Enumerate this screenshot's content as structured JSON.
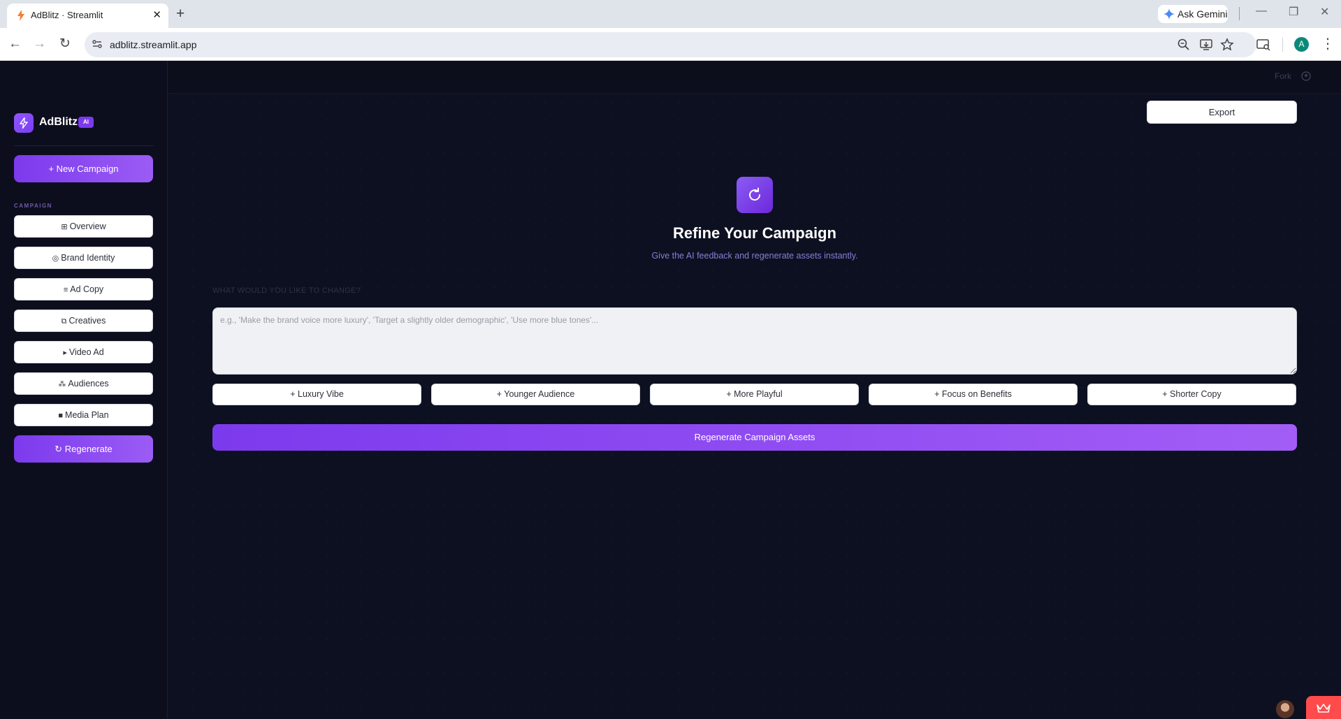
{
  "browser": {
    "tab_title": "AdBlitz · Streamlit",
    "tab_close": "✕",
    "new_tab": "+",
    "gemini_label": "Ask Gemini",
    "window_controls": {
      "minimize": "—",
      "restore": "❐",
      "close": "✕"
    },
    "nav": {
      "back": "←",
      "forward": "→",
      "reload": "↻"
    },
    "url": "adblitz.streamlit.app",
    "profile_initial": "A",
    "menu": "⋮"
  },
  "header": {
    "fork_label": "Fork"
  },
  "sidebar": {
    "brand_name": "AdBlitz",
    "brand_badge": "AI",
    "new_campaign": "+ New Campaign",
    "section_label": "CAMPAIGN",
    "items": [
      {
        "icon": "⊞",
        "label": "Overview"
      },
      {
        "icon": "◎",
        "label": "Brand Identity"
      },
      {
        "icon": "≡",
        "label": "Ad Copy"
      },
      {
        "icon": "⧉",
        "label": "Creatives"
      },
      {
        "icon": "▸",
        "label": "Video Ad"
      },
      {
        "icon": "⁂",
        "label": "Audiences"
      },
      {
        "icon": "■",
        "label": "Media Plan"
      }
    ],
    "regenerate": "↻ Regenerate"
  },
  "main": {
    "export_label": "Export",
    "title": "Refine Your Campaign",
    "subtitle": "Give the AI feedback and regenerate assets instantly.",
    "field_label": "WHAT WOULD YOU LIKE TO CHANGE?",
    "feedback_placeholder": "e.g., 'Make the brand voice more luxury', 'Target a slightly older demographic', 'Use more blue tones'...",
    "feedback_value": "",
    "chips": [
      "+ Luxury Vibe",
      "+ Younger Audience",
      "+ More Playful",
      "+ Focus on Benefits",
      "+ Shorter Copy"
    ],
    "regenerate_label": "Regenerate Campaign Assets"
  },
  "colors": {
    "accent": "#7c3aed",
    "accent_light": "#9b5cf5",
    "app_bg": "#0d1020",
    "subtitle": "#8b7cd8",
    "streamlit_badge": "#ff4b4b"
  }
}
